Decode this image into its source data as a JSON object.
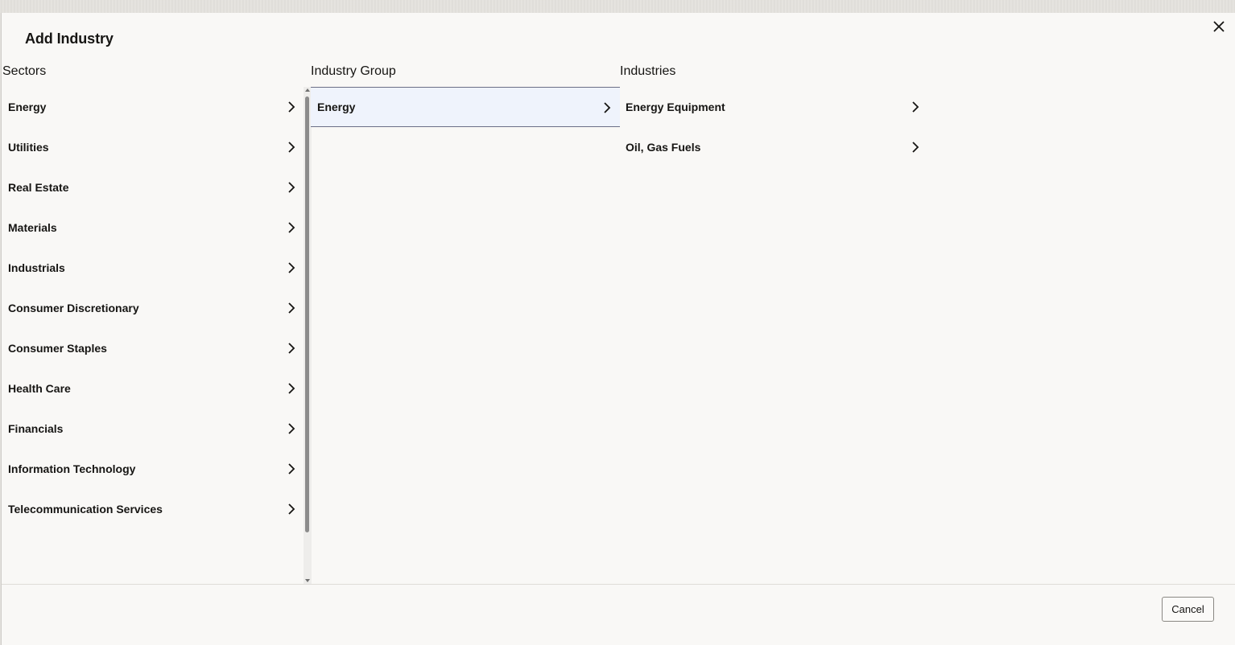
{
  "dialog": {
    "title": "Add Industry",
    "close_icon": "close-icon",
    "cancel_label": "Cancel"
  },
  "columns": {
    "sectors_header": "Sectors",
    "groups_header": "Industry Group",
    "industries_header": "Industries"
  },
  "sectors": [
    {
      "label": "Energy"
    },
    {
      "label": "Utilities"
    },
    {
      "label": "Real Estate"
    },
    {
      "label": "Materials"
    },
    {
      "label": "Industrials"
    },
    {
      "label": "Consumer Discretionary"
    },
    {
      "label": "Consumer Staples"
    },
    {
      "label": "Health Care"
    },
    {
      "label": "Financials"
    },
    {
      "label": "Information Technology"
    },
    {
      "label": "Telecommunication Services"
    }
  ],
  "groups": [
    {
      "label": "Energy",
      "selected": true
    }
  ],
  "industries": [
    {
      "label": "Energy Equipment"
    },
    {
      "label": "Oil, Gas Fuels"
    }
  ],
  "colors": {
    "selected_bg": "#eff3fc",
    "selected_border": "#6b6f86",
    "dialog_bg": "#f9f8f6"
  }
}
